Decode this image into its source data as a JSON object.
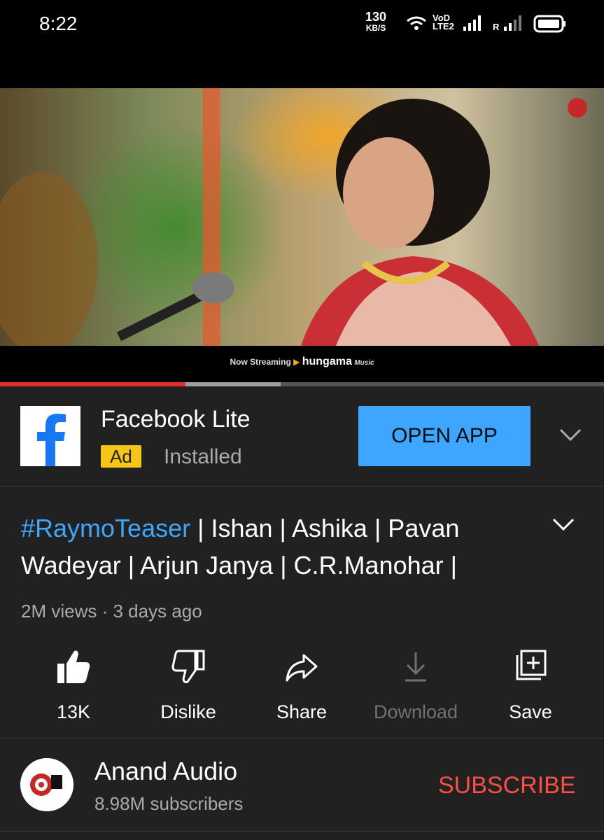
{
  "status_bar": {
    "time": "8:22",
    "net_speed": "130",
    "net_speed_unit": "KB/S",
    "volte": "VoD",
    "volte_sub": "LTE2",
    "roaming": "R",
    "icons": [
      "wifi-icon",
      "signal-icon",
      "battery-icon"
    ]
  },
  "video": {
    "streaming_text": "Now Streaming",
    "streaming_brand": "hungama",
    "streaming_brand_suffix": "Music",
    "progress_played": 0.307,
    "progress_buffered": 0.465
  },
  "ad": {
    "app_name": "Facebook Lite",
    "badge": "Ad",
    "status": "Installed",
    "cta": "OPEN APP"
  },
  "video_info": {
    "title_hashtag": "#RaymoTeaser",
    "title_rest": " | Ishan | Ashika | Pavan Wadeyar | Arjun Janya | C.R.Manohar |",
    "views": "2M views",
    "separator": "·",
    "age": "3 days ago"
  },
  "actions": [
    {
      "label": "13K"
    },
    {
      "label": "Dislike"
    },
    {
      "label": "Share"
    },
    {
      "label": "Download"
    },
    {
      "label": "Save"
    }
  ],
  "channel": {
    "name": "Anand Audio",
    "subscribers": "8.98M subscribers",
    "subscribe_label": "SUBSCRIBE"
  },
  "colors": {
    "background": "#212121",
    "link_blue": "#3ea6ff",
    "subscribe_red": "#ff4e45",
    "progress_red": "#e52d27",
    "ad_badge": "#f5c518"
  }
}
